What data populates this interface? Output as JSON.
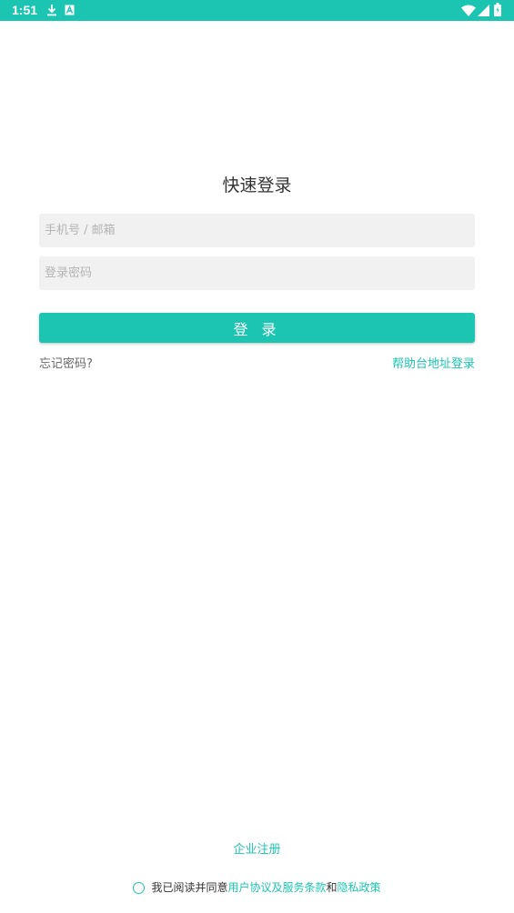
{
  "status_bar": {
    "time": "1:51",
    "background": "#1cc5b1",
    "left_icons": [
      "download-icon",
      "font-a-icon"
    ],
    "right_icons": [
      "wifi-icon",
      "signal-icon",
      "battery-icon"
    ]
  },
  "login": {
    "title": "快速登录",
    "account_placeholder": "手机号 / 邮箱",
    "account_value": "",
    "password_placeholder": "登录密码",
    "password_value": "",
    "login_button": "登 录",
    "forgot_password": "忘记密码?",
    "help_login": "帮助台地址登录"
  },
  "footer": {
    "register": "企业注册",
    "agreement": {
      "checked": false,
      "prefix": "我已阅读并同意",
      "terms_link": "用户协议及服务条款",
      "and": "和",
      "privacy_link": "隐私政策"
    }
  },
  "colors": {
    "accent": "#1cc5b1",
    "input_bg": "#f1f1f1",
    "text": "#333333",
    "muted": "#666666",
    "placeholder": "#b4b4b4"
  }
}
